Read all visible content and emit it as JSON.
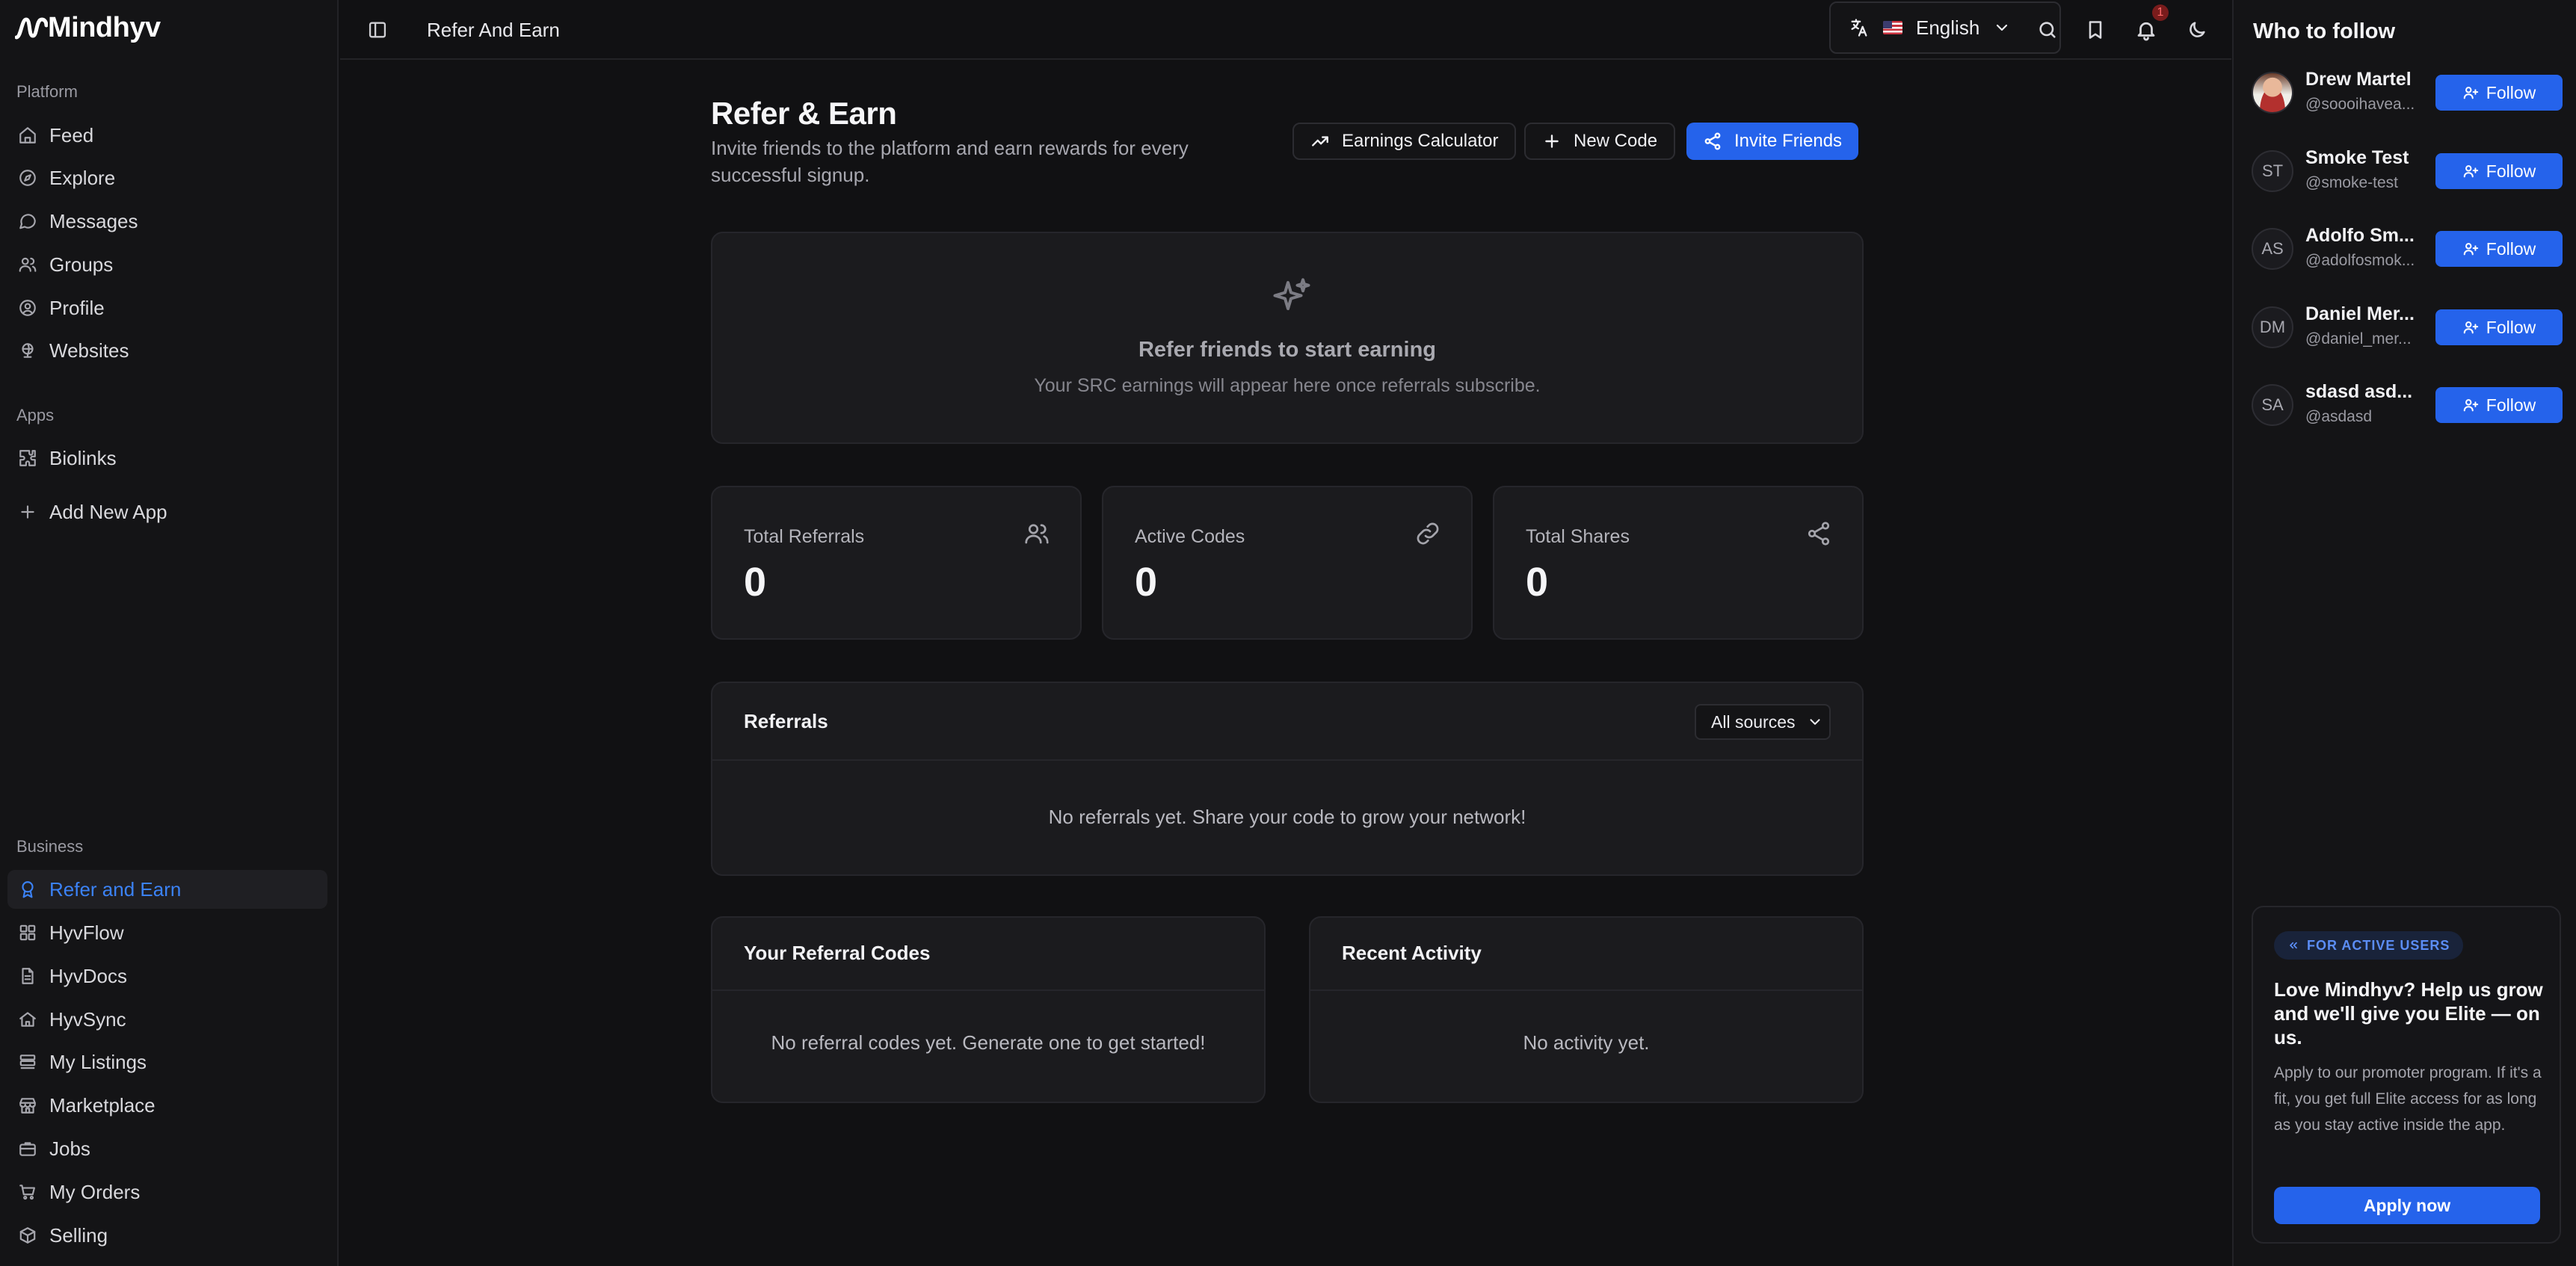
{
  "app": {
    "brand": "Mindhyv"
  },
  "sidebar": {
    "sections": {
      "platform": "Platform",
      "apps": "Apps",
      "business": "Business"
    },
    "platform_items": [
      {
        "label": "Feed",
        "icon": "home-icon"
      },
      {
        "label": "Explore",
        "icon": "compass-icon"
      },
      {
        "label": "Messages",
        "icon": "message-icon"
      },
      {
        "label": "Groups",
        "icon": "users-icon"
      },
      {
        "label": "Profile",
        "icon": "user-circle-icon"
      },
      {
        "label": "Websites",
        "icon": "globe-icon"
      }
    ],
    "apps_items": [
      {
        "label": "Biolinks",
        "icon": "puzzle-icon"
      },
      {
        "label": "Add New App",
        "icon": "plus-icon"
      }
    ],
    "business_items": [
      {
        "label": "Refer and Earn",
        "icon": "award-icon",
        "active": true
      },
      {
        "label": "HyvFlow",
        "icon": "grid-icon"
      },
      {
        "label": "HyvDocs",
        "icon": "file-icon"
      },
      {
        "label": "HyvSync",
        "icon": "house-sync-icon"
      },
      {
        "label": "My Listings",
        "icon": "list-icon"
      },
      {
        "label": "Marketplace",
        "icon": "store-icon"
      },
      {
        "label": "Jobs",
        "icon": "briefcase-icon"
      },
      {
        "label": "My Orders",
        "icon": "cart-icon"
      },
      {
        "label": "Selling",
        "icon": "package-icon"
      }
    ]
  },
  "topbar": {
    "breadcrumb": "Refer And Earn",
    "language": "English",
    "notification_count": "1"
  },
  "page": {
    "title": "Refer & Earn",
    "subtitle": "Invite friends to the platform and earn rewards for every successful signup.",
    "buttons": {
      "calculator": "Earnings Calculator",
      "new_code": "New Code",
      "invite": "Invite Friends"
    },
    "hero": {
      "title": "Refer friends to start earning",
      "subtitle": "Your SRC earnings will appear here once referrals subscribe."
    },
    "stats": [
      {
        "label": "Total Referrals",
        "value": "0",
        "icon": "users-icon"
      },
      {
        "label": "Active Codes",
        "value": "0",
        "icon": "link-icon"
      },
      {
        "label": "Total Shares",
        "value": "0",
        "icon": "share-icon"
      }
    ],
    "referrals": {
      "title": "Referrals",
      "filter": "All sources",
      "empty": "No referrals yet. Share your code to grow your network!"
    },
    "codes": {
      "title": "Your Referral Codes",
      "empty": "No referral codes yet. Generate one to get started!"
    },
    "activity": {
      "title": "Recent Activity",
      "empty": "No activity yet."
    }
  },
  "who_to_follow": {
    "title": "Who to follow",
    "button_label": "Follow",
    "users": [
      {
        "name": "Drew Martel",
        "handle": "@soooihavea...",
        "initials": ""
      },
      {
        "name": "Smoke Test",
        "handle": "@smoke-test",
        "initials": "ST"
      },
      {
        "name": "Adolfo Sm...",
        "handle": "@adolfosmok...",
        "initials": "AS"
      },
      {
        "name": "Daniel Mer...",
        "handle": "@daniel_mer...",
        "initials": "DM"
      },
      {
        "name": "sdasd asd...",
        "handle": "@asdasd",
        "initials": "SA"
      }
    ]
  },
  "promo": {
    "badge": "FOR ACTIVE USERS",
    "title": "Love Mindhyv? Help us grow and we'll give you Elite — on us.",
    "text": "Apply to our promoter program. If it's a fit, you get full Elite access for as long as you stay active inside the app.",
    "button": "Apply now"
  },
  "colors": {
    "accent": "#2563eb",
    "active_text": "#3b82f6",
    "background": "#111113",
    "panel": "#141416",
    "card": "#1b1b1e"
  }
}
